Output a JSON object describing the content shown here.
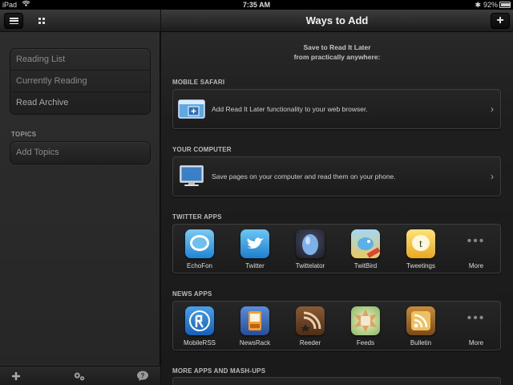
{
  "status_bar": {
    "carrier": "iPad",
    "time": "7:35 AM",
    "battery": "92%"
  },
  "sidebar": {
    "menu_icon": "hamburger-icon",
    "grid_icon": "grid-icon",
    "items": [
      {
        "label": "Reading List"
      },
      {
        "label": "Currently Reading"
      },
      {
        "label": "Read Archive"
      }
    ],
    "topics_header": "TOPICS",
    "topics_items": [
      {
        "label": "Add Topics"
      }
    ],
    "bottom_icons": [
      "plus-icon",
      "gears-icon",
      "help-icon"
    ]
  },
  "main": {
    "title": "Ways to Add",
    "add_button": "+",
    "intro_line1": "Save to Read It Later",
    "intro_line2": "from practically anywhere:",
    "sections": {
      "mobile_safari": {
        "title": "MOBILE SAFARI",
        "text": "Add Read It Later functionality to your web browser."
      },
      "your_computer": {
        "title": "YOUR COMPUTER",
        "text": "Save pages on your computer and read them on your phone."
      },
      "twitter_apps": {
        "title": "TWITTER APPS",
        "apps": [
          "EchoFon",
          "Twitter",
          "Twittelator",
          "TwitBird",
          "Tweetings",
          "More"
        ]
      },
      "news_apps": {
        "title": "NEWS APPS",
        "apps": [
          "MobileRSS",
          "NewsRack",
          "Reeder",
          "Feeds",
          "Bulletin",
          "More"
        ]
      },
      "more_apps": {
        "title": "MORE APPS AND MASH-UPS"
      }
    }
  },
  "colors": {
    "background": "#1a1a1a",
    "card_border": "#3e3e3e",
    "text": "#cfcfcf"
  }
}
